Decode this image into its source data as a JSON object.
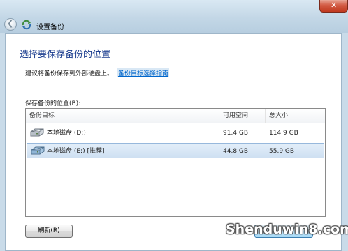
{
  "window": {
    "title": "设置备份",
    "close_glyph": "✕",
    "back_glyph": "❮"
  },
  "page": {
    "heading": "选择要保存备份的位置",
    "info_text": "建议将备份保存到外部硬盘上。",
    "info_link": "备份目标选择指南",
    "list_label": "保存备份的位置(B):"
  },
  "list": {
    "columns": [
      "备份目标",
      "可用空间",
      "总大小"
    ],
    "rows": [
      {
        "name": "本地磁盘 (D:)",
        "free": "91.4 GB",
        "total": "114.9 GB",
        "selected": false
      },
      {
        "name": "本地磁盘 (E:) [推荐]",
        "free": "44.8 GB",
        "total": "55.9 GB",
        "selected": true
      }
    ]
  },
  "buttons": {
    "refresh": "刷新(R)"
  },
  "watermark": "Shenduwin8.com",
  "icons": {
    "app": "backup-icon",
    "drive": "hard-drive-icon"
  }
}
